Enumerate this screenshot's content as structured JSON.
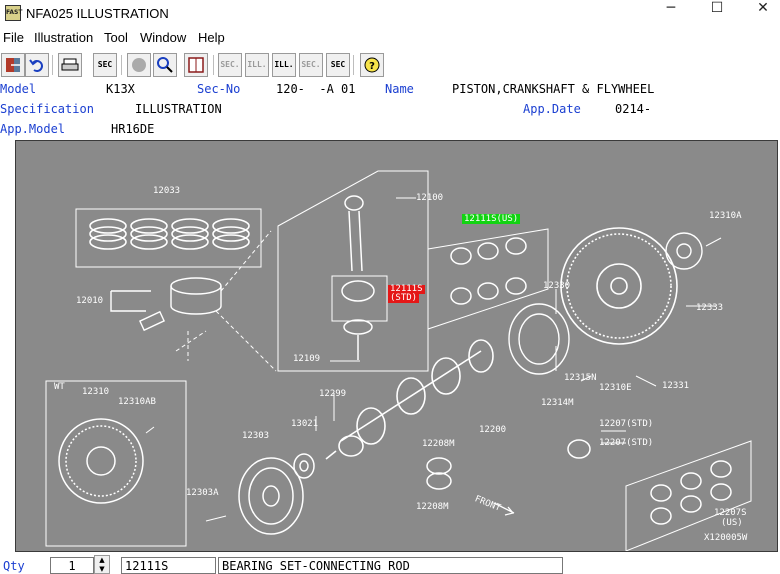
{
  "window": {
    "icon": "app-icon",
    "icon_text": "FAST",
    "title": "NFA025  ILLUSTRATION",
    "minimize": "─",
    "maximize": "☐",
    "close": "✕"
  },
  "menu": [
    "File",
    "Illustration",
    "Tool",
    "Window",
    "Help"
  ],
  "toolbar": {
    "sec1": "SEC",
    "sec2": "SEC.",
    "ill1": "ILL.",
    "ill2": "ILL.",
    "sec3": "SEC.",
    "sec4": "SEC"
  },
  "info": {
    "model_label": "Model",
    "model_value": "K13X",
    "secno_label": "Sec-No",
    "secno_value": "120-  -A 01",
    "name_label": "Name",
    "name_value": "PISTON,CRANKSHAFT & FLYWHEEL",
    "spec_label": "Specification",
    "spec_value": "ILLUSTRATION",
    "appdate_label": "App.Date",
    "appdate_value": "0214-",
    "appmodel_label": "App.Model",
    "appmodel_value": "HR16DE"
  },
  "illustration": {
    "parts": {
      "p12033": "12033",
      "p12010": "12010",
      "p12100": "12100",
      "p12111s_us": "12111S(US)",
      "p12111s_std_1": "12111S",
      "p12111s_std_2": "(STD)",
      "p12109": "12109",
      "p12330": "12330",
      "p12310a": "12310A",
      "p12333": "12333",
      "p12315n": "12315N",
      "p12310e": "12310E",
      "p12331": "12331",
      "p12314m": "12314M",
      "p12299": "12299",
      "p12200": "12200",
      "wt": "WT",
      "p12310": "12310",
      "p12310ab": "12310AB",
      "p12303": "12303",
      "p13021": "13021",
      "p12208m_1": "12208M",
      "p12208m_2": "12208M",
      "p12207_std_1": "12207(STD)",
      "p12207_std_2": "12207(STD)",
      "p12303a": "12303A",
      "front": "FRONT",
      "p12207s": "12207S",
      "p12207s_us": "(US)",
      "code": "X120005W"
    }
  },
  "status": {
    "qty_label": "Qty",
    "qty_value": "1",
    "spin_up": "▲",
    "spin_down": "▼",
    "part_no": "12111S",
    "part_name": "BEARING SET-CONNECTING ROD"
  }
}
